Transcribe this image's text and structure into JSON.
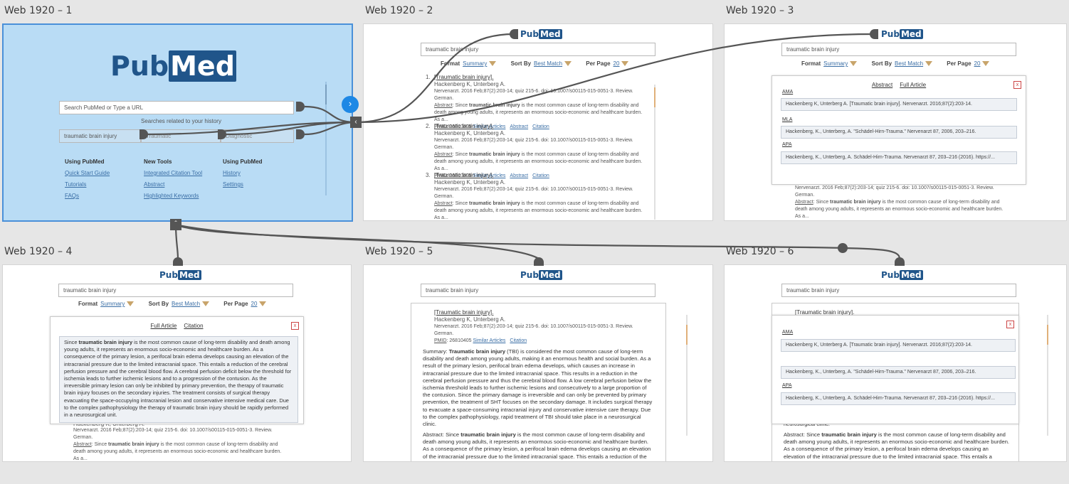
{
  "artboards": [
    {
      "label": "Web 1920 – 1"
    },
    {
      "label": "Web 1920 – 2"
    },
    {
      "label": "Web 1920 – 3"
    },
    {
      "label": "Web 1920 – 4"
    },
    {
      "label": "Web 1920 – 5"
    },
    {
      "label": "Web 1920 – 6"
    }
  ],
  "logo": {
    "pub": "Pub",
    "med": "Med"
  },
  "home": {
    "search_placeholder": "Search PubMed or Type a URL",
    "history_caption": "Searches related to your history",
    "history_chips": [
      "traumatic brain injury",
      "Traumatic",
      "Diagnostic"
    ],
    "columns": [
      {
        "heading": "Using PubMed",
        "links": [
          "Quick Start Guide",
          "Tutorials",
          "FAQs"
        ]
      },
      {
        "heading": "New Tools",
        "links": [
          "Integrated Citation Tool",
          "Abstract",
          "Highlighted Keywords"
        ]
      },
      {
        "heading": "Using PubMed",
        "links": [
          "History",
          "Settings"
        ]
      }
    ]
  },
  "search_value": "traumatic brain injury",
  "format_row": {
    "format_label": "Format",
    "format_value": "Summary",
    "sort_label": "Sort By",
    "sort_value": "Best Match",
    "per_page_label": "Per Page",
    "per_page_value": "20"
  },
  "result": {
    "title": "[Traumatic brain injury].",
    "authors": "Hackenberg K, Unterberg A.",
    "journal": "Nervenarzt. 2016 Feb;87(2):203-14; quiz 215-6. doi: 10.1007/s00115-015-0051-3. Review. German.",
    "abstract_label": "Abstract",
    "abstract_prefix": ": Since ",
    "abstract_bold": "traumatic brain injury",
    "abstract_suffix": " is the most common cause of long-term disability and death among young adults, it represents an enormous socio-economic and healthcare burden. As a...",
    "pmid_label": "PMID",
    "pmid": ": 26810405",
    "link_similar": "Similar Articles",
    "link_abstract": "Abstract",
    "link_citation": "Citation",
    "link_full": "Full Article"
  },
  "numbers": [
    "1.",
    "2.",
    "3."
  ],
  "citations": {
    "ama_label": "AMA",
    "ama": "Hackenberg K, Unterberg A. [Traumatic brain injury]. Nervenarzt. 2016;87(2):203-14.",
    "mla_label": "MLA",
    "mla": "Hackenberg, K., Unterberg, A. \"Schädel-Hirn-Trauma.\" Nervenarzt 87, 2006, 203–216.",
    "apa_label": "APA",
    "apa": "Hackenberg, K., Unterberg, A. Schädel-Hirn-Trauma. Nervenarzt 87, 203–216 (2016). https://..."
  },
  "close": "x",
  "abstract_popup": {
    "pre": "Since ",
    "bold": "traumatic brain injury",
    "post": " is the most common cause of long-term disability and death among young adults, it represents an enormous socio-economic and healthcare burden. As a consequence of the primary lesion, a perifocal brain edema develops causing an elevation of the intracranial pressure due to the limited intracranial space. This entails a reduction of the cerebral perfusion pressure and the cerebral blood flow. A cerebral perfusion deficit below the threshold for ischemia leads to further ischemic lesions and to a progression of the contusion. As the irreversible primary lesion can only be inhibited by primary prevention, the therapy of traumatic brain injury focuses on the secondary injuries. The treatment consists of surgical therapy evacuating the space-occupying intracranial lesion and conservative intensive medical care. Due to the complex pathophysiology the therapy of traumatic brain injury should be rapidly performed in a neurosurgical unit."
  },
  "full_article": {
    "summary_pre": "Summary: ",
    "summary_bold": "Traumatic brain injury",
    "summary_post": " (TBI) is considered the most common cause of long-term disability and death among young adults, making it an enormous health and social burden. As a result of the primary lesion, perifocal brain edema develops, which causes an increase in intracranial pressure due to the limited intracranial space. This results in a reduction in the cerebral perfusion pressure and thus the cerebral blood flow. A low cerebral perfusion below the ischemia threshold leads to further ischemic lesions and consecutively to a large proportion of the contusion. Since the primary damage is irreversible and can only be prevented by primary prevention, the treatment of SHT focuses on the secondary damage. It includes surgical therapy to evacuate a space-consuming intracranial injury and conservative intensive care therapy. Due to the complex pathophysiology, rapid treatment of TBI should take place in a neurosurgical clinic.",
    "abstract_pre": "Abstract: Since ",
    "abstract_bold": "traumatic brain injury",
    "abstract_post": " is the most common cause of long-term disability and death among young adults, it represents an enormous socio-economic and healthcare burden. As a consequence of the primary lesion, a perifocal brain edema develops causing an elevation of the intracranial pressure due to the limited intracranial space. This entails a reduction of the",
    "tail": "neurosurgical clinic."
  }
}
